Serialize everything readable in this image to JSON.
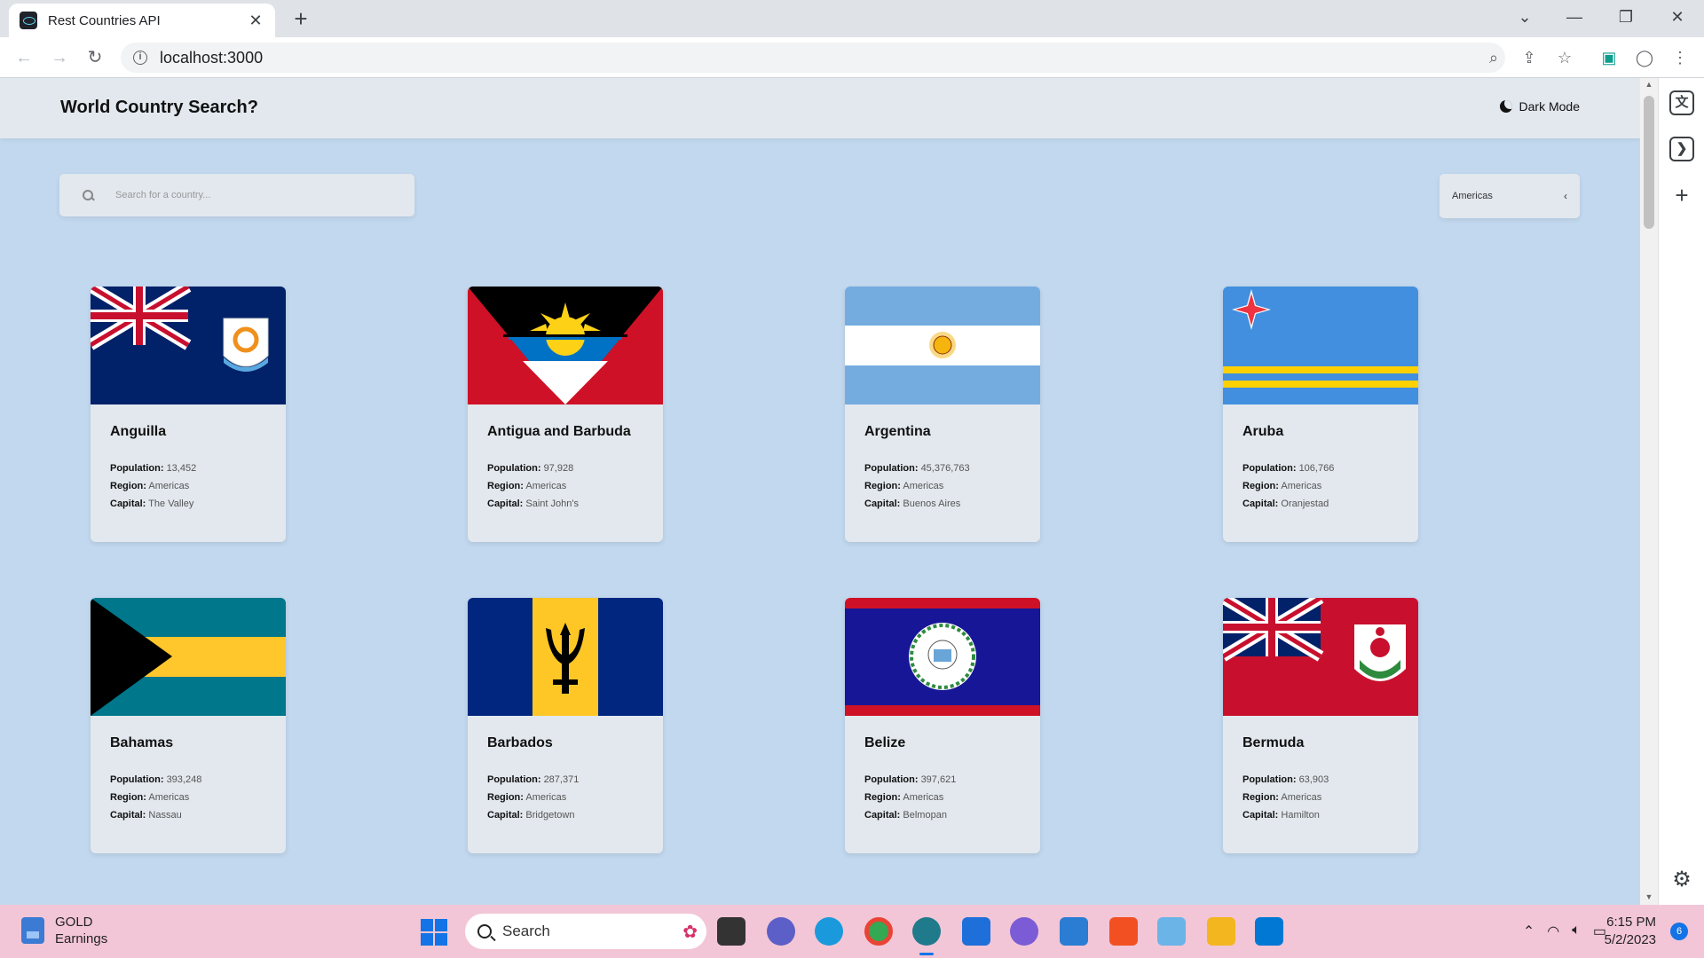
{
  "browser": {
    "tab_title": "Rest Countries API",
    "url": "localhost:3000"
  },
  "app": {
    "title": "World Country Search?",
    "dark_mode_label": "Dark Mode",
    "search_placeholder": "Search for a country...",
    "region_selected": "Americas"
  },
  "labels": {
    "population": "Population:",
    "region": "Region:",
    "capital": "Capital:"
  },
  "countries": [
    {
      "name": "Anguilla",
      "population": "13,452",
      "region": "Americas",
      "capital": "The Valley",
      "flag": "anguilla-flag"
    },
    {
      "name": "Antigua and Barbuda",
      "population": "97,928",
      "region": "Americas",
      "capital": "Saint John's",
      "flag": "antigua-flag"
    },
    {
      "name": "Argentina",
      "population": "45,376,763",
      "region": "Americas",
      "capital": "Buenos Aires",
      "flag": "argentina-flag"
    },
    {
      "name": "Aruba",
      "population": "106,766",
      "region": "Americas",
      "capital": "Oranjestad",
      "flag": "aruba-flag"
    },
    {
      "name": "Bahamas",
      "population": "393,248",
      "region": "Americas",
      "capital": "Nassau",
      "flag": "bahamas-flag"
    },
    {
      "name": "Barbados",
      "population": "287,371",
      "region": "Americas",
      "capital": "Bridgetown",
      "flag": "barbados-flag"
    },
    {
      "name": "Belize",
      "population": "397,621",
      "region": "Americas",
      "capital": "Belmopan",
      "flag": "belize-flag"
    },
    {
      "name": "Bermuda",
      "population": "63,903",
      "region": "Americas",
      "capital": "Hamilton",
      "flag": "bermuda-flag"
    }
  ],
  "taskbar": {
    "weather_title": "GOLD",
    "weather_subtitle": "Earnings",
    "search_label": "Search",
    "time": "6:15 PM",
    "date": "5/2/2023",
    "notification_count": "6"
  }
}
